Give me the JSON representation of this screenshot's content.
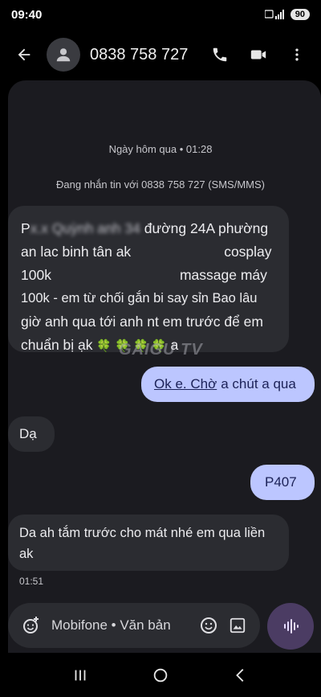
{
  "status_bar": {
    "time": "09:40",
    "battery": "90"
  },
  "header": {
    "title": "0838 758 727"
  },
  "conversation": {
    "date_label": "Ngày hôm qua • 01:28",
    "info_label": "Đang nhắn tin với 0838 758 727 (SMS/MMS)",
    "messages": [
      {
        "direction": "incoming",
        "line1_start": "P",
        "line1_blurred": "x.x Quỳnh anh 34",
        "line1_rest": " đường 24A phường",
        "line2_start": "an lac binh tân ak",
        "line2_end": "cosplay",
        "line3_start": "100k",
        "line3_end": "massage máy",
        "line4": "100k - em từ chối gắn bi say sỉn Bao lâu",
        "line5": "giờ anh qua tới anh nt em trước để em",
        "line6_start": "chuẩn bị ạk ",
        "line6_emoji": "🍀 🍀 🍀 🍀",
        "line6_end": " a"
      },
      {
        "direction": "outgoing",
        "link": "Ok e. Chờ",
        "rest": "a chút a qua"
      },
      {
        "direction": "incoming",
        "text": "Dạ"
      },
      {
        "direction": "outgoing",
        "text": "P407"
      },
      {
        "direction": "incoming",
        "text": "Da ah tắm trước cho mát nhé em qua liền ak"
      }
    ],
    "time_label": "01:51",
    "watermark": "GAIGU TV"
  },
  "compose": {
    "placeholder": "Mobifone • Văn bản"
  },
  "colors": {
    "accent": "#bcc6ff",
    "voice": "#4b3c63",
    "panel": "#1b1b20"
  }
}
